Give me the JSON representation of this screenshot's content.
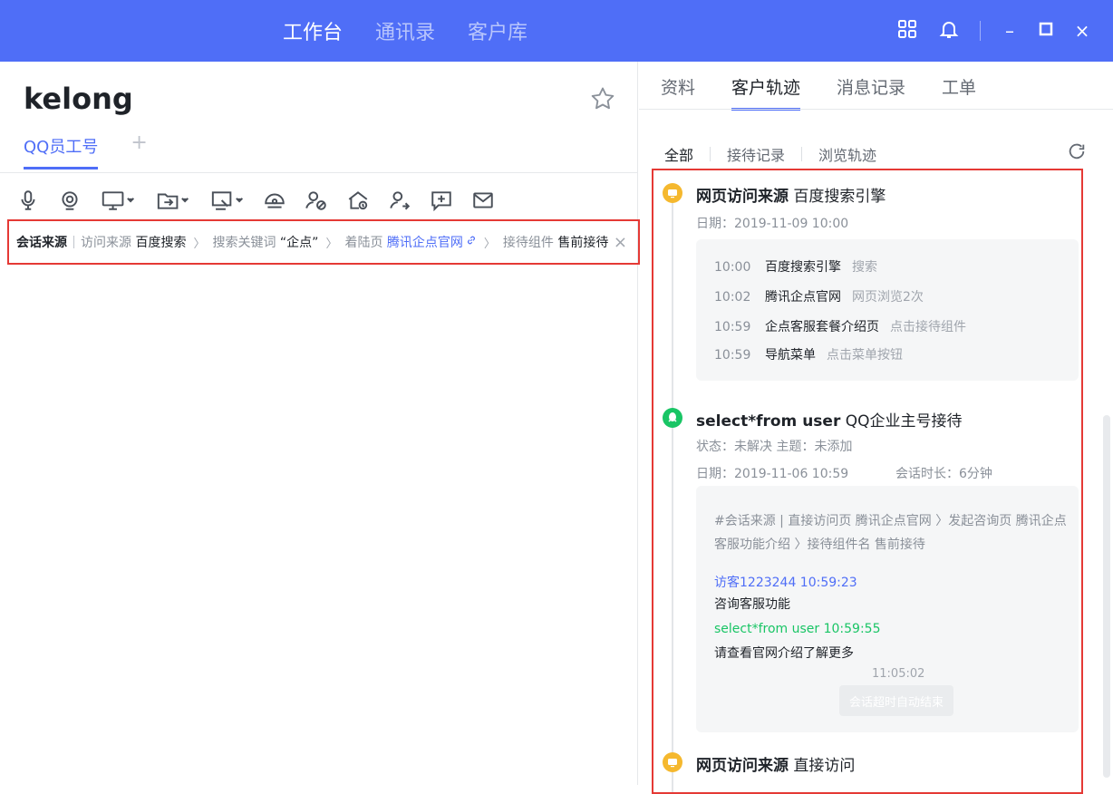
{
  "topbar": {
    "tabs": [
      "工作台",
      "通讯录",
      "客户库"
    ],
    "active_tab": 0,
    "icons": [
      "grid-icon",
      "bell-icon",
      "minimize-icon",
      "maximize-icon",
      "close-icon"
    ],
    "bg_color": "#4f6ef7"
  },
  "customer": {
    "name": "kelong",
    "subtab": "QQ员工号",
    "add_label": "+"
  },
  "toolbar": {
    "icons": [
      "microphone-icon",
      "camera-icon",
      "screen-share-icon",
      "file-transfer-icon",
      "screenshot-icon",
      "remote-support-icon",
      "block-user-icon",
      "home-icon",
      "transfer-user-icon",
      "add-note-icon",
      "mail-icon"
    ]
  },
  "session_source": {
    "label": "会话来源",
    "visit_source_label": "访问来源",
    "visit_source_value": "百度搜索",
    "keyword_label": "搜索关键词",
    "keyword_value": "“企点”",
    "landing_label": "着陆页",
    "landing_value": "腾讯企点官网",
    "widget_label": "接待组件",
    "widget_value": "售前接待",
    "close": "×"
  },
  "right_tabs": [
    "资料",
    "客户轨迹",
    "消息记录",
    "工单"
  ],
  "right_active_tab": 1,
  "filters": [
    "全部",
    "接待记录",
    "浏览轨迹"
  ],
  "filter_active": 0,
  "timeline": {
    "event1": {
      "title_bold": "网页访问来源",
      "title_rest": "百度搜索引擎",
      "date": "日期：2019-11-09   10:00",
      "steps": [
        {
          "time": "10:00",
          "name": "百度搜索引擎",
          "action": "搜索"
        },
        {
          "time": "10:02",
          "name": "腾讯企点官网",
          "action": "网页浏览2次"
        },
        {
          "time": "10:59",
          "name": "企点客服套餐介绍页",
          "action": "点击接待组件"
        },
        {
          "time": "10:59",
          "name": "导航菜单",
          "action": "点击菜单按钮"
        }
      ]
    },
    "event2": {
      "title_bold": "select*from user",
      "title_rest": "QQ企业主号接待",
      "status": "状态：未解决      主题：未添加",
      "date": "日期：2019-11-06   10:59",
      "duration": "会话时长：6分钟",
      "source": "#会话来源 | 直接访问页 腾讯企点官网 〉发起咨询页 腾讯企点客服功能介绍 〉接待组件名 售前接待",
      "visitor_line": "访客1223244   10:59:23",
      "visitor_msg": "咨询客服功能",
      "agent_line": "select*from user   10:59:55",
      "agent_msg": "请查看官网介绍了解更多",
      "end_time": "11:05:02",
      "end_label": "会话超时自动结束"
    },
    "event3": {
      "title_bold": "网页访问来源",
      "title_rest": "直接访问"
    }
  }
}
